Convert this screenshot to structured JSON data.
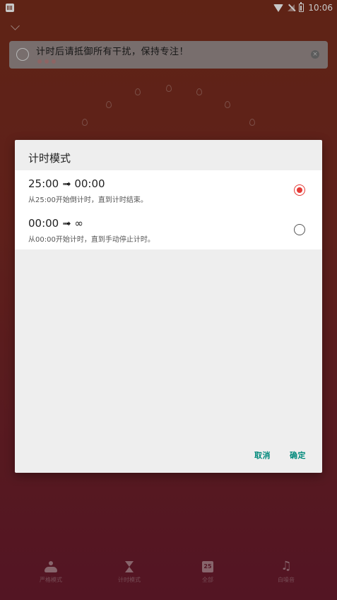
{
  "status_bar": {
    "time": "10:06",
    "icons": [
      "app-notification-icon",
      "wifi-icon",
      "no-signal-icon",
      "battery-charging-icon"
    ]
  },
  "header": {
    "collapse_icon": "chevron-down-icon"
  },
  "task": {
    "title": "计时后请抵御所有干扰，保持专注！",
    "dots": 3,
    "radio_icon": "circle-icon",
    "close_icon": "close-circle-icon"
  },
  "dialog": {
    "title": "计时模式",
    "options": [
      {
        "time": "25:00 ➟ 00:00",
        "description": "从25:00开始倒计时，直到计时结束。",
        "selected": true
      },
      {
        "time": "00:00 ➟ ∞",
        "description": "从00:00开始计时，直到手动停止计时。",
        "selected": false
      }
    ],
    "cancel_label": "取消",
    "ok_label": "确定",
    "accent_color": "#e53935",
    "button_color": "#00897b"
  },
  "bottom_nav": {
    "items": [
      {
        "label": "严格模式",
        "icon": "meditation-icon"
      },
      {
        "label": "计时模式",
        "icon": "hourglass-icon"
      },
      {
        "label": "全部",
        "icon": "calendar-icon",
        "icon_text": "25"
      },
      {
        "label": "白噪音",
        "icon": "music-note-icon"
      }
    ]
  }
}
